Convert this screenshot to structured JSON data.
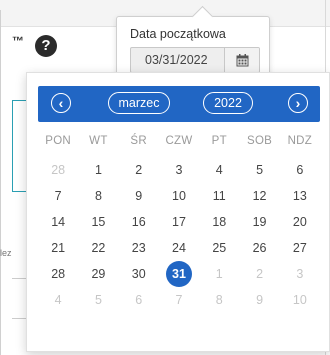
{
  "background": {
    "tm_mark": "™",
    "help_icon_glyph": "?",
    "fragment_text": "lez"
  },
  "date_field": {
    "label": "Data początkowa",
    "value": "03/31/2022",
    "calendar_icon": "calendar-icon"
  },
  "calendar": {
    "prev_label": "‹",
    "next_label": "›",
    "month": "marzec",
    "year": "2022",
    "weekdays": [
      "PON",
      "WT",
      "ŚR",
      "CZW",
      "PT",
      "SOB",
      "NDZ"
    ],
    "days": [
      {
        "d": "28",
        "muted": true
      },
      {
        "d": "1"
      },
      {
        "d": "2"
      },
      {
        "d": "3"
      },
      {
        "d": "4"
      },
      {
        "d": "5"
      },
      {
        "d": "6"
      },
      {
        "d": "7"
      },
      {
        "d": "8"
      },
      {
        "d": "9"
      },
      {
        "d": "10"
      },
      {
        "d": "11"
      },
      {
        "d": "12"
      },
      {
        "d": "13"
      },
      {
        "d": "14"
      },
      {
        "d": "15"
      },
      {
        "d": "16"
      },
      {
        "d": "17"
      },
      {
        "d": "18"
      },
      {
        "d": "19"
      },
      {
        "d": "20"
      },
      {
        "d": "21"
      },
      {
        "d": "22"
      },
      {
        "d": "23"
      },
      {
        "d": "24"
      },
      {
        "d": "25"
      },
      {
        "d": "26"
      },
      {
        "d": "27"
      },
      {
        "d": "28"
      },
      {
        "d": "29"
      },
      {
        "d": "30"
      },
      {
        "d": "31",
        "selected": true
      },
      {
        "d": "1",
        "muted": true
      },
      {
        "d": "2",
        "muted": true
      },
      {
        "d": "3",
        "muted": true
      },
      {
        "d": "4",
        "muted": true
      },
      {
        "d": "5",
        "muted": true
      },
      {
        "d": "6",
        "muted": true
      },
      {
        "d": "7",
        "muted": true
      },
      {
        "d": "8",
        "muted": true
      },
      {
        "d": "9",
        "muted": true
      },
      {
        "d": "10",
        "muted": true
      }
    ],
    "accent_color": "#2166c4"
  }
}
